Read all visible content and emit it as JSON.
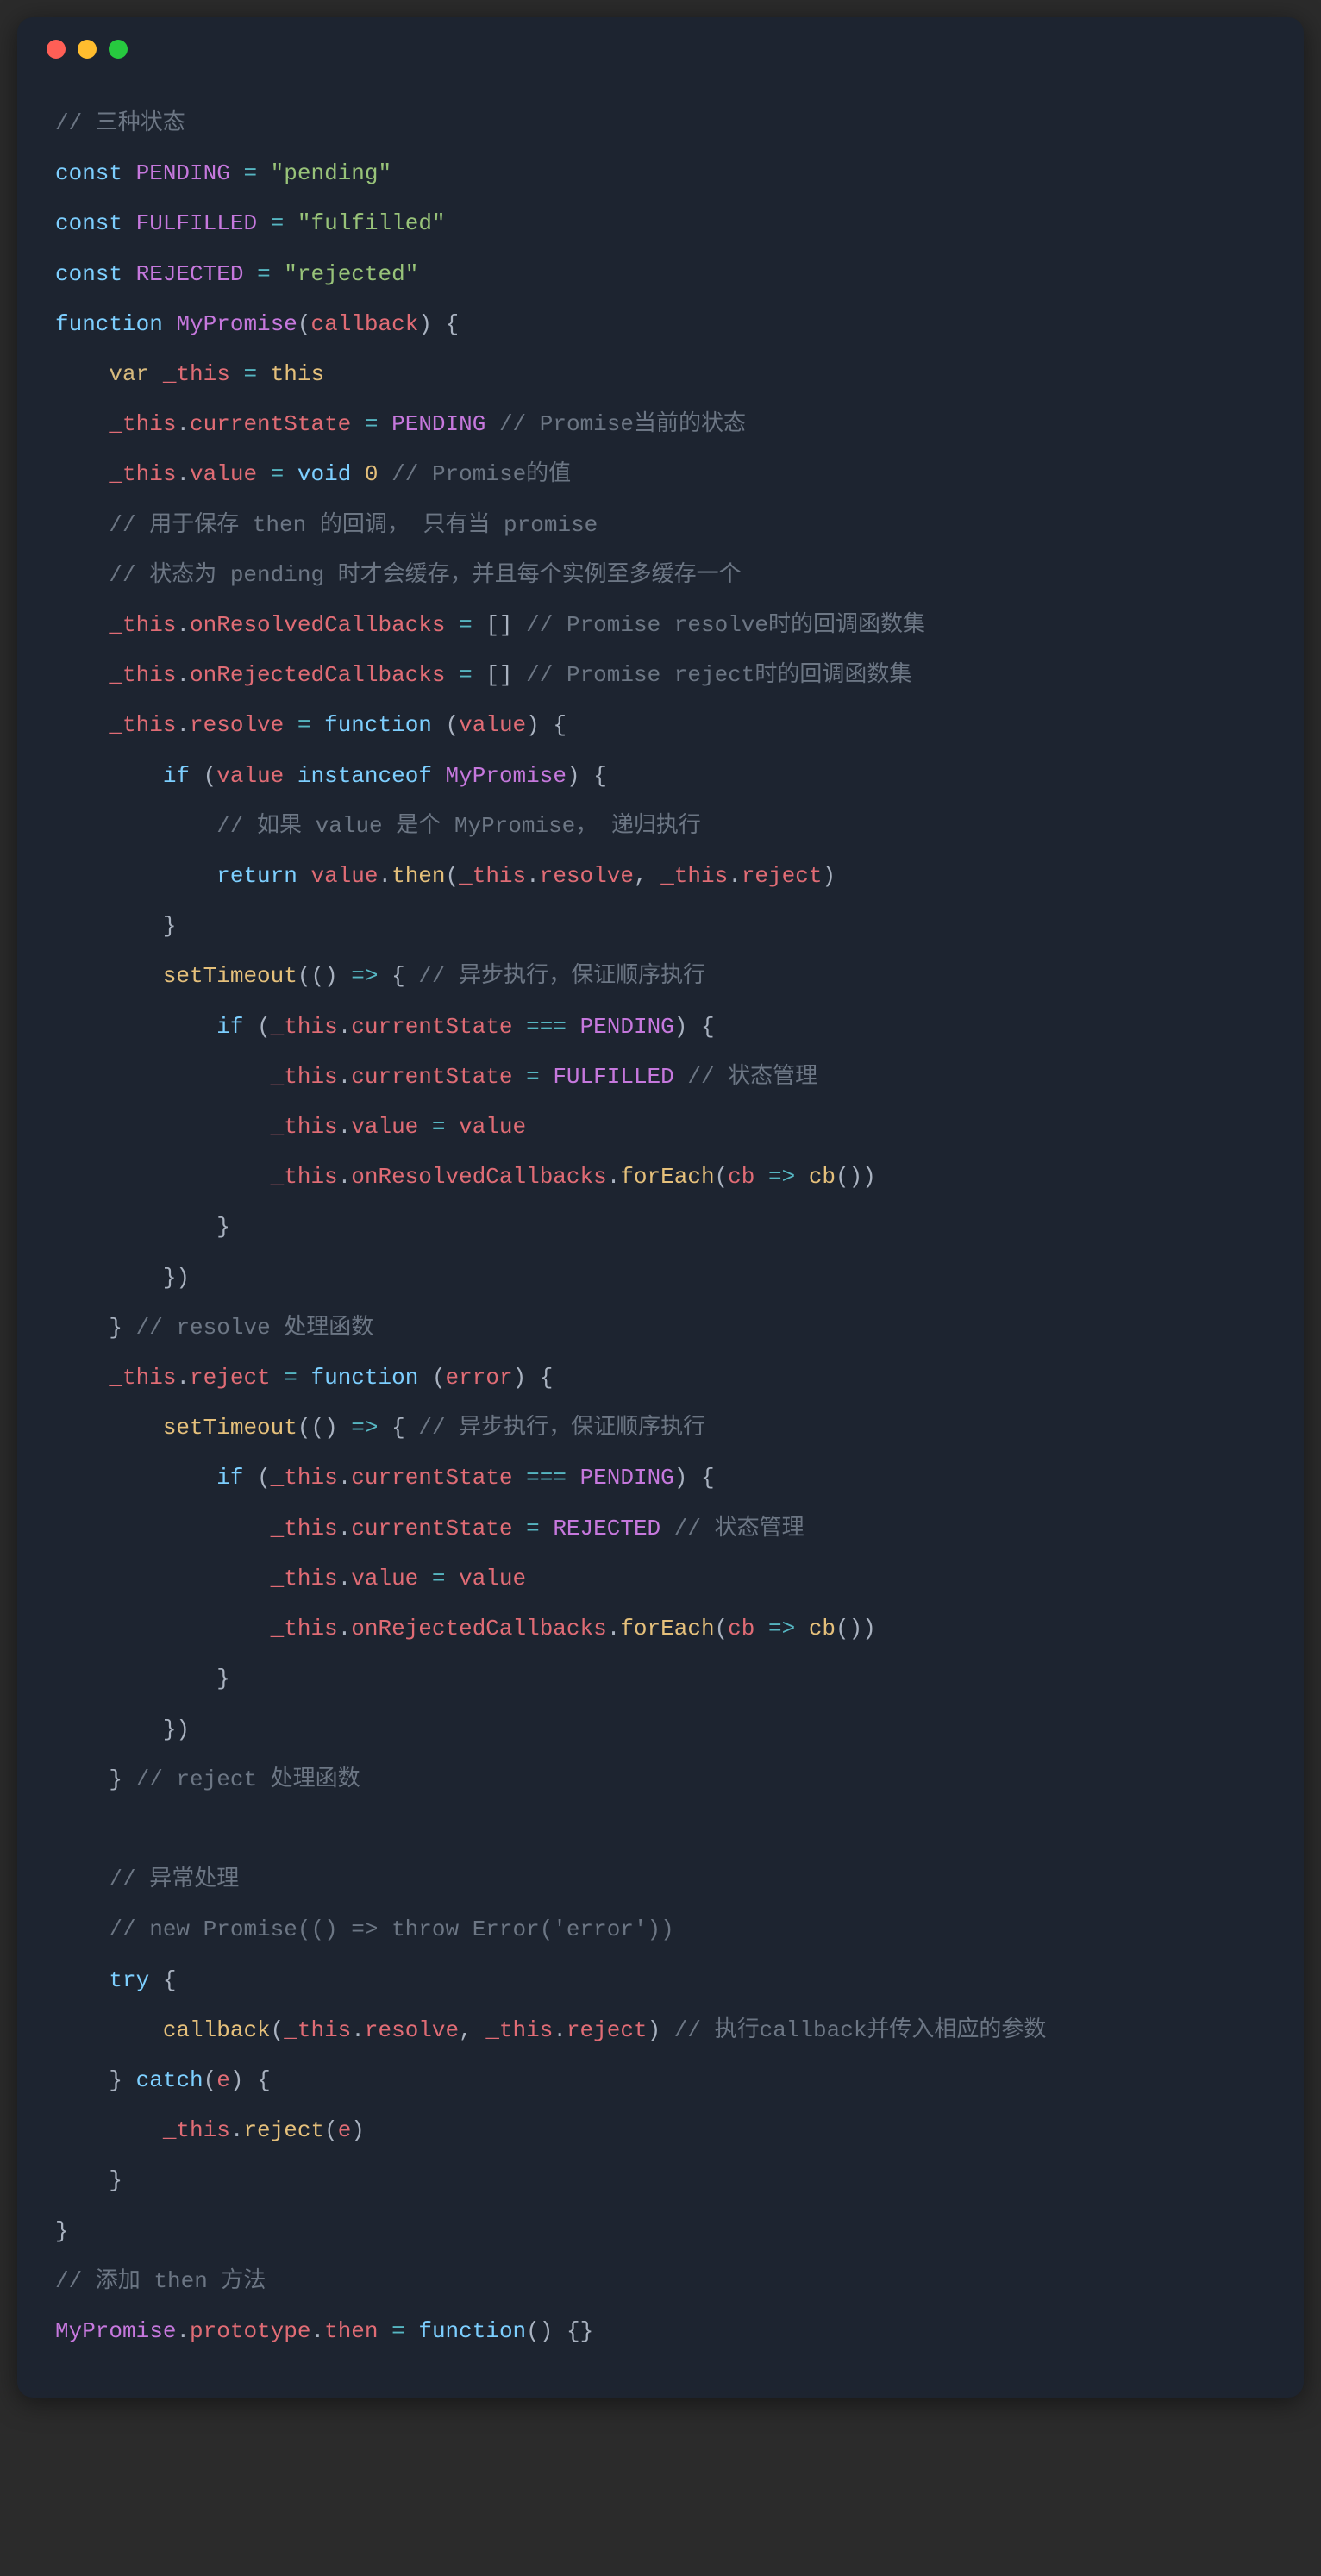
{
  "code": {
    "l01_comment": "// 三种状态",
    "l02_const": "const",
    "l02_name": "PENDING",
    "l02_eq": "=",
    "l02_val": "\"pending\"",
    "l03_const": "const",
    "l03_name": "FULFILLED",
    "l03_eq": "=",
    "l03_val": "\"fulfilled\"",
    "l04_const": "const",
    "l04_name": "REJECTED",
    "l04_eq": "=",
    "l04_val": "\"rejected\"",
    "l05_fn": "function",
    "l05_name": "MyPromise",
    "l05_paren_open": "(",
    "l05_param": "callback",
    "l05_paren_close": ")",
    "l05_brace": "{",
    "l06_var": "var",
    "l06_name": "_this",
    "l06_eq": "=",
    "l06_this": "this",
    "l07_obj": "_this",
    "l07_dot": ".",
    "l07_prop": "currentState",
    "l07_eq": "=",
    "l07_val": "PENDING",
    "l07_comment": "// Promise当前的状态",
    "l08_obj": "_this",
    "l08_dot": ".",
    "l08_prop": "value",
    "l08_eq": "=",
    "l08_void": "void",
    "l08_zero": "0",
    "l08_comment": "// Promise的值",
    "l09_comment": "// 用于保存 then 的回调， 只有当 promise",
    "l10_comment": "// 状态为 pending 时才会缓存，并且每个实例至多缓存一个",
    "l11_obj": "_this",
    "l11_dot": ".",
    "l11_prop": "onResolvedCallbacks",
    "l11_eq": "=",
    "l11_val": "[]",
    "l11_comment": "// Promise resolve时的回调函数集",
    "l12_obj": "_this",
    "l12_dot": ".",
    "l12_prop": "onRejectedCallbacks",
    "l12_eq": "=",
    "l12_val": "[]",
    "l12_comment": "// Promise reject时的回调函数集",
    "l13_obj": "_this",
    "l13_dot": ".",
    "l13_prop": "resolve",
    "l13_eq": "=",
    "l13_fn": "function",
    "l13_paren_open": "(",
    "l13_param": "value",
    "l13_paren_close": ")",
    "l13_brace": "{",
    "l14_if": "if",
    "l14_open": "(",
    "l14_val": "value",
    "l14_inst": "instanceof",
    "l14_cls": "MyPromise",
    "l14_close": ")",
    "l14_brace": "{",
    "l15_comment": "// 如果 value 是个 MyPromise， 递归执行",
    "l16_return": "return",
    "l16_val": "value",
    "l16_dot": ".",
    "l16_then": "then",
    "l16_open": "(",
    "l16_a1o": "_this",
    "l16_a1d": ".",
    "l16_a1p": "resolve",
    "l16_comma": ",",
    "l16_a2o": "_this",
    "l16_a2d": ".",
    "l16_a2p": "reject",
    "l16_close": ")",
    "l17_brace": "}",
    "l18_fn": "setTimeout",
    "l18_open": "((",
    "l18_paren": ")",
    "l18_arrow": "=>",
    "l18_brace": "{",
    "l18_comment": "// 异步执行，保证顺序执行",
    "l19_if": "if",
    "l19_open": "(",
    "l19_obj": "_this",
    "l19_dot": ".",
    "l19_prop": "currentState",
    "l19_eq": "===",
    "l19_val": "PENDING",
    "l19_close": ")",
    "l19_brace": "{",
    "l20_obj": "_this",
    "l20_dot": ".",
    "l20_prop": "currentState",
    "l20_eq": "=",
    "l20_val": "FULFILLED",
    "l20_comment": "// 状态管理",
    "l21_obj": "_this",
    "l21_dot": ".",
    "l21_prop": "value",
    "l21_eq": "=",
    "l21_val": "value",
    "l22_obj": "_this",
    "l22_dot": ".",
    "l22_prop": "onResolvedCallbacks",
    "l22_dot2": ".",
    "l22_fn": "forEach",
    "l22_open": "(",
    "l22_cb": "cb",
    "l22_arrow": "=>",
    "l22_cb2": "cb",
    "l22_call": "())",
    "l23_brace": "}",
    "l24_brace": "})",
    "l25_brace": "}",
    "l25_comment": "// resolve 处理函数",
    "l26_obj": "_this",
    "l26_dot": ".",
    "l26_prop": "reject",
    "l26_eq": "=",
    "l26_fn": "function",
    "l26_paren_open": "(",
    "l26_param": "error",
    "l26_paren_close": ")",
    "l26_brace": "{",
    "l27_fn": "setTimeout",
    "l27_open": "((",
    "l27_paren": ")",
    "l27_arrow": "=>",
    "l27_brace": "{",
    "l27_comment": "// 异步执行，保证顺序执行",
    "l28_if": "if",
    "l28_open": "(",
    "l28_obj": "_this",
    "l28_dot": ".",
    "l28_prop": "currentState",
    "l28_eq": "===",
    "l28_val": "PENDING",
    "l28_close": ")",
    "l28_brace": "{",
    "l29_obj": "_this",
    "l29_dot": ".",
    "l29_prop": "currentState",
    "l29_eq": "=",
    "l29_val": "REJECTED",
    "l29_comment": "// 状态管理",
    "l30_obj": "_this",
    "l30_dot": ".",
    "l30_prop": "value",
    "l30_eq": "=",
    "l30_val": "value",
    "l31_obj": "_this",
    "l31_dot": ".",
    "l31_prop": "onRejectedCallbacks",
    "l31_dot2": ".",
    "l31_fn": "forEach",
    "l31_open": "(",
    "l31_cb": "cb",
    "l31_arrow": "=>",
    "l31_cb2": "cb",
    "l31_call": "())",
    "l32_brace": "}",
    "l33_brace": "})",
    "l34_brace": "}",
    "l34_comment": "// reject 处理函数",
    "l36_comment": "// 异常处理",
    "l37_comment": "// new Promise(() => throw Error('error'))",
    "l38_try": "try",
    "l38_brace": "{",
    "l39_fn": "callback",
    "l39_open": "(",
    "l39_a1o": "_this",
    "l39_a1d": ".",
    "l39_a1p": "resolve",
    "l39_comma": ",",
    "l39_a2o": "_this",
    "l39_a2d": ".",
    "l39_a2p": "reject",
    "l39_close": ")",
    "l39_comment": "// 执行callback并传入相应的参数",
    "l40_brace": "}",
    "l40_catch": "catch",
    "l40_open": "(",
    "l40_e": "e",
    "l40_close": ")",
    "l40_brace2": "{",
    "l41_obj": "_this",
    "l41_dot": ".",
    "l41_prop": "reject",
    "l41_open": "(",
    "l41_e": "e",
    "l41_close": ")",
    "l42_brace": "}",
    "l43_brace": "}",
    "l44_comment": "// 添加 then 方法",
    "l45_obj": "MyPromise",
    "l45_dot": ".",
    "l45_proto": "prototype",
    "l45_dot2": ".",
    "l45_then": "then",
    "l45_eq": "=",
    "l45_fn": "function",
    "l45_paren": "()",
    "l45_body": "{}"
  }
}
